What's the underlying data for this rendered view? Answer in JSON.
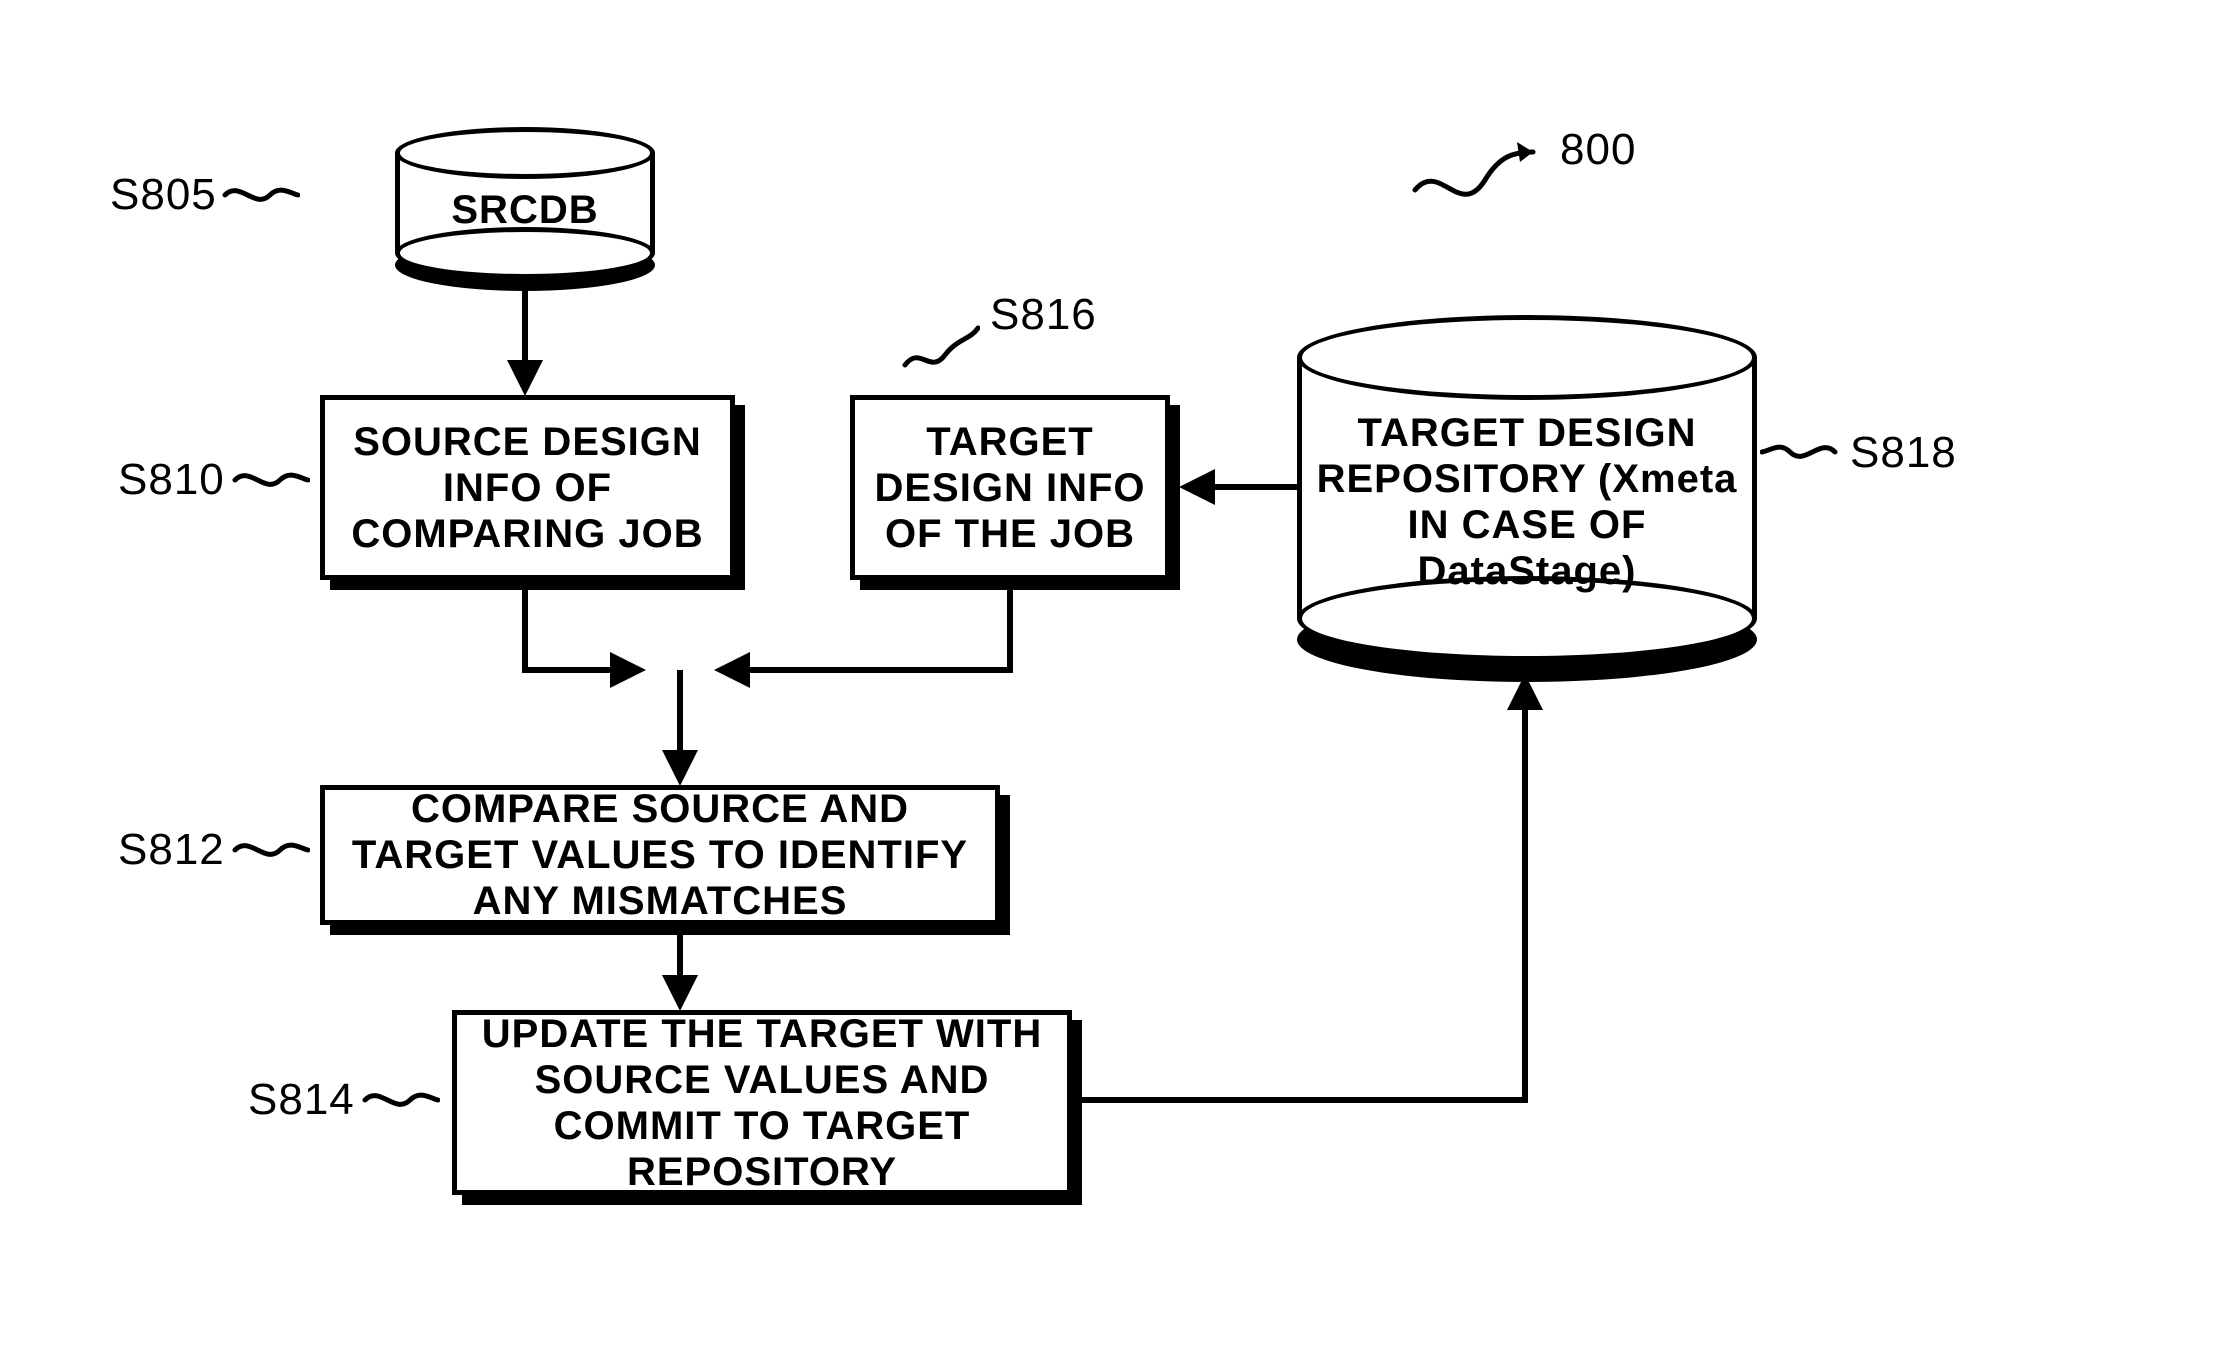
{
  "figure_ref": {
    "number": "800"
  },
  "nodes": {
    "s805": {
      "label": "S805",
      "text": "SRCDB"
    },
    "s810": {
      "label": "S810",
      "text": "SOURCE DESIGN INFO OF COMPARING JOB"
    },
    "s816": {
      "label": "S816",
      "text": "TARGET DESIGN INFO OF THE JOB"
    },
    "s818": {
      "label": "S818",
      "text": "TARGET DESIGN REPOSITORY (Xmeta IN CASE OF DataStage)"
    },
    "s812": {
      "label": "S812",
      "text": "COMPARE SOURCE AND TARGET VALUES TO IDENTIFY ANY MISMATCHES"
    },
    "s814": {
      "label": "S814",
      "text": "UPDATE THE TARGET WITH SOURCE VALUES AND COMMIT TO TARGET REPOSITORY"
    }
  }
}
